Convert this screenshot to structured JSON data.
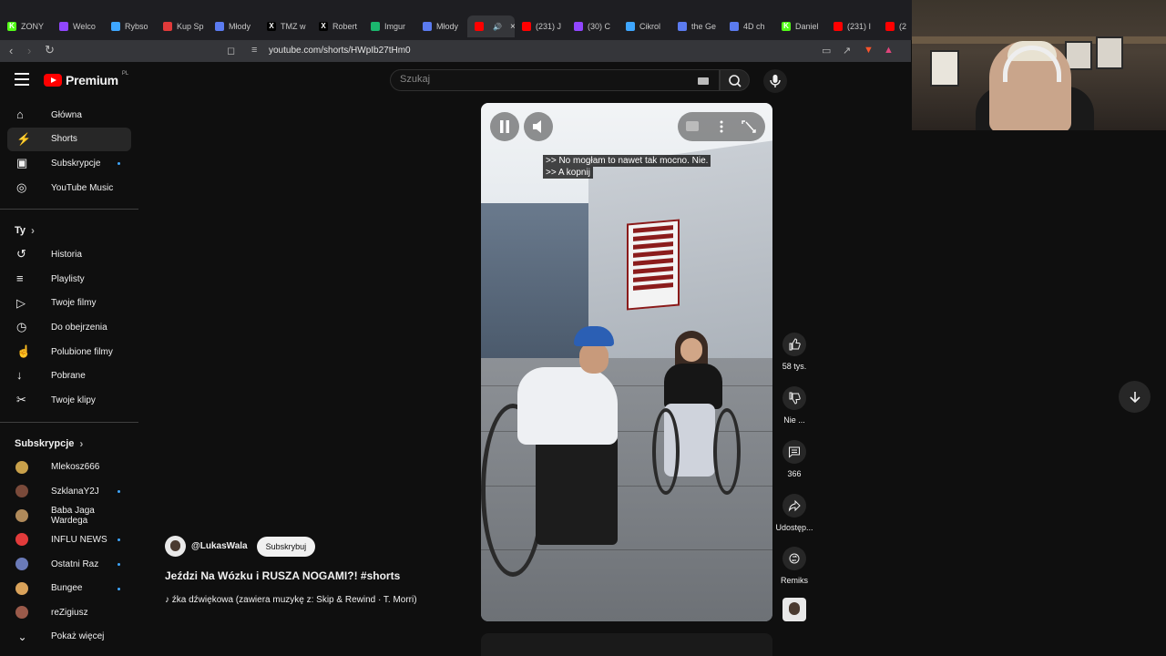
{
  "browser": {
    "tabs": [
      {
        "label": "ZONY",
        "color": "#53fc18",
        "glyph": "K"
      },
      {
        "label": "Welco",
        "color": "#9146ff",
        "glyph": ""
      },
      {
        "label": "Rybso",
        "color": "#3ea6ff",
        "glyph": ""
      },
      {
        "label": "Kup Sp",
        "color": "#e03a3a",
        "glyph": ""
      },
      {
        "label": "Młody",
        "color": "#5b7bf0",
        "glyph": ""
      },
      {
        "label": "TMZ w",
        "color": "#000000",
        "glyph": "X"
      },
      {
        "label": "Robert",
        "color": "#000000",
        "glyph": "X"
      },
      {
        "label": "Imgur",
        "color": "#1bb76e",
        "glyph": ""
      },
      {
        "label": "Młody",
        "color": "#5b7bf0",
        "glyph": ""
      },
      {
        "label": "",
        "color": "#ff0000",
        "glyph": "",
        "active": true
      },
      {
        "label": "(231) J",
        "color": "#ff0000",
        "glyph": ""
      },
      {
        "label": "(30) C",
        "color": "#9146ff",
        "glyph": ""
      },
      {
        "label": "Cikrol",
        "color": "#3ea6ff",
        "glyph": ""
      },
      {
        "label": "the Ge",
        "color": "#5b7bf0",
        "glyph": ""
      },
      {
        "label": "4D ch",
        "color": "#5b7bf0",
        "glyph": ""
      },
      {
        "label": "Daniel",
        "color": "#53fc18",
        "glyph": "K"
      },
      {
        "label": "(231) I",
        "color": "#ff0000",
        "glyph": ""
      },
      {
        "label": "(2",
        "color": "#ff0000",
        "glyph": ""
      }
    ],
    "url": "youtube.com/shorts/HWpIb27tHm0"
  },
  "header": {
    "brand": "Premium",
    "country": "PL",
    "search_placeholder": "Szukaj"
  },
  "sidebar": {
    "main": [
      {
        "label": "Główna",
        "icon": "home-icon",
        "active": false
      },
      {
        "label": "Shorts",
        "icon": "shorts-icon",
        "active": true
      },
      {
        "label": "Subskrypcje",
        "icon": "subscriptions-icon",
        "dot": true
      },
      {
        "label": "YouTube Music",
        "icon": "music-icon"
      }
    ],
    "you_header": "Ty",
    "you": [
      {
        "label": "Historia",
        "icon": "history-icon"
      },
      {
        "label": "Playlisty",
        "icon": "playlists-icon"
      },
      {
        "label": "Twoje filmy",
        "icon": "your-videos-icon"
      },
      {
        "label": "Do obejrzenia",
        "icon": "watch-later-icon"
      },
      {
        "label": "Polubione filmy",
        "icon": "liked-icon"
      },
      {
        "label": "Pobrane",
        "icon": "download-icon"
      },
      {
        "label": "Twoje klipy",
        "icon": "clips-icon"
      }
    ],
    "subs_header": "Subskrypcje",
    "subs": [
      {
        "label": "Mlekosz666",
        "color": "#c8a04a",
        "dot": false
      },
      {
        "label": "SzklanaY2J",
        "color": "#7a4a3a",
        "dot": true
      },
      {
        "label": "Baba Jaga Wardega",
        "color": "#b08a5a",
        "dot": false
      },
      {
        "label": "INFLU NEWS",
        "color": "#e23b3b",
        "dot": true
      },
      {
        "label": "Ostatni Raz",
        "color": "#6a7ab8",
        "dot": true
      },
      {
        "label": "Bungee",
        "color": "#d9a25a",
        "dot": true
      },
      {
        "label": "reZigiusz",
        "color": "#9a5a4a",
        "dot": false
      }
    ],
    "show_more": "Pokaż więcej"
  },
  "video": {
    "caption_lines": [
      ">> No mogłam to nawet tak mocno. Nie.",
      ">> A kopnij"
    ],
    "channel_handle": "@LukasWala",
    "subscribe_label": "Subskrybuj",
    "title": "Jeździ Na Wózku i RUSZA NOGAMI?! #shorts",
    "sound": "źka dźwiękowa (zawiera muzykę z: Skip & Rewind · T. Morri)"
  },
  "actions": {
    "likes": "58 tys.",
    "dislike": "Nie ...",
    "comments": "366",
    "share": "Udostęp...",
    "remix": "Remiks"
  }
}
